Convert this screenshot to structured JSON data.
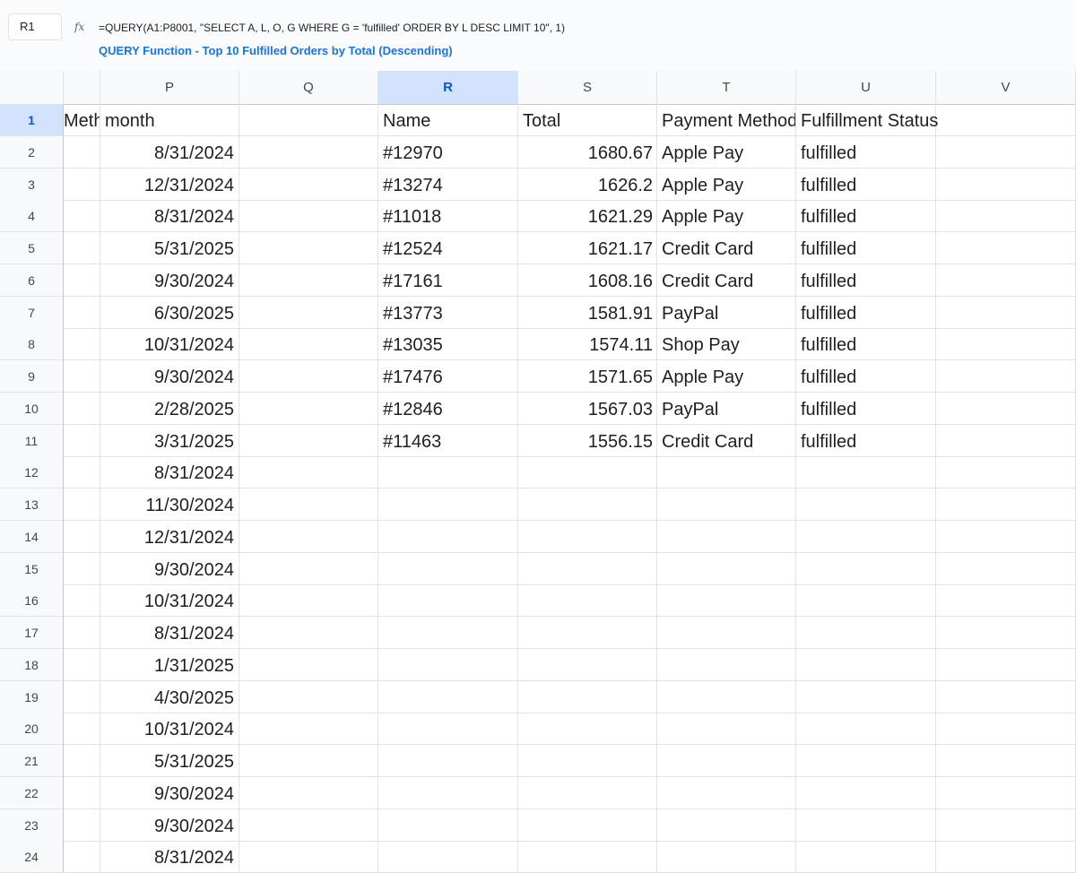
{
  "formula_bar": {
    "name_box": "R1",
    "fx": "fx",
    "formula": "=QUERY(A1:P8001, \"SELECT A, L, O, G WHERE G = 'fulfilled' ORDER BY L DESC LIMIT 10\", 1)",
    "hint": "QUERY Function - Top 10 Fulfilled Orders by Total (Descending)"
  },
  "columns": [
    "",
    "P",
    "Q",
    "R",
    "S",
    "T",
    "U",
    "V"
  ],
  "selected_column": "R",
  "header_row": {
    "o_partial": "Method",
    "p": "month",
    "q": "",
    "r": "Name",
    "s": "Total",
    "t": "Payment Method",
    "u": "Fulfillment Status",
    "v": ""
  },
  "rows": [
    {
      "n": "2",
      "p": "8/31/2024",
      "r": "#12970",
      "s": "1680.67",
      "t": "Apple Pay",
      "u": "fulfilled"
    },
    {
      "n": "3",
      "p": "12/31/2024",
      "r": "#13274",
      "s": "1626.2",
      "t": "Apple Pay",
      "u": "fulfilled"
    },
    {
      "n": "4",
      "p": "8/31/2024",
      "r": "#11018",
      "s": "1621.29",
      "t": "Apple Pay",
      "u": "fulfilled"
    },
    {
      "n": "5",
      "p": "5/31/2025",
      "r": "#12524",
      "s": "1621.17",
      "t": "Credit Card",
      "u": "fulfilled"
    },
    {
      "n": "6",
      "p": "9/30/2024",
      "r": "#17161",
      "s": "1608.16",
      "t": "Credit Card",
      "u": "fulfilled"
    },
    {
      "n": "7",
      "p": "6/30/2025",
      "r": "#13773",
      "s": "1581.91",
      "t": "PayPal",
      "u": "fulfilled"
    },
    {
      "n": "8",
      "p": "10/31/2024",
      "r": "#13035",
      "s": "1574.11",
      "t": "Shop Pay",
      "u": "fulfilled"
    },
    {
      "n": "9",
      "p": "9/30/2024",
      "r": "#17476",
      "s": "1571.65",
      "t": "Apple Pay",
      "u": "fulfilled"
    },
    {
      "n": "10",
      "p": "2/28/2025",
      "r": "#12846",
      "s": "1567.03",
      "t": "PayPal",
      "u": "fulfilled"
    },
    {
      "n": "11",
      "p": "3/31/2025",
      "r": "#11463",
      "s": "1556.15",
      "t": "Credit Card",
      "u": "fulfilled"
    },
    {
      "n": "12",
      "p": "8/31/2024",
      "r": "",
      "s": "",
      "t": "",
      "u": ""
    },
    {
      "n": "13",
      "p": "11/30/2024",
      "r": "",
      "s": "",
      "t": "",
      "u": ""
    },
    {
      "n": "14",
      "p": "12/31/2024",
      "r": "",
      "s": "",
      "t": "",
      "u": ""
    },
    {
      "n": "15",
      "p": "9/30/2024",
      "r": "",
      "s": "",
      "t": "",
      "u": ""
    },
    {
      "n": "16",
      "p": "10/31/2024",
      "r": "",
      "s": "",
      "t": "",
      "u": ""
    },
    {
      "n": "17",
      "p": "8/31/2024",
      "r": "",
      "s": "",
      "t": "",
      "u": ""
    },
    {
      "n": "18",
      "p": "1/31/2025",
      "r": "",
      "s": "",
      "t": "",
      "u": ""
    },
    {
      "n": "19",
      "p": "4/30/2025",
      "r": "",
      "s": "",
      "t": "",
      "u": ""
    },
    {
      "n": "20",
      "p": "10/31/2024",
      "r": "",
      "s": "",
      "t": "",
      "u": ""
    },
    {
      "n": "21",
      "p": "5/31/2025",
      "r": "",
      "s": "",
      "t": "",
      "u": ""
    },
    {
      "n": "22",
      "p": "9/30/2024",
      "r": "",
      "s": "",
      "t": "",
      "u": ""
    },
    {
      "n": "23",
      "p": "9/30/2024",
      "r": "",
      "s": "",
      "t": "",
      "u": ""
    },
    {
      "n": "24",
      "p": "8/31/2024",
      "r": "",
      "s": "",
      "t": "",
      "u": ""
    }
  ],
  "colors": {
    "accent": "#1a73e8",
    "selected_header_bg": "#d3e3fd",
    "grid_line": "#e1e3e1"
  }
}
